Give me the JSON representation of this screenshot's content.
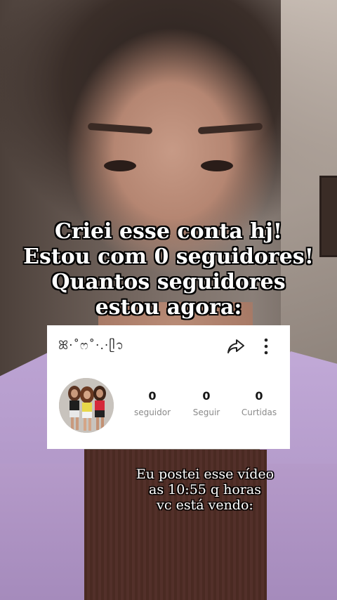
{
  "caption_top": {
    "lines": [
      "Criei esse conta hj!",
      "Estou com 0 seguidores!",
      "Quantos seguidores",
      "estou agora:"
    ]
  },
  "profile_card": {
    "username": "ꕤ·˚ෆ˚·.·ᥫ᭡",
    "share_icon": "share-arrow-icon",
    "more_icon": "vertical-dots-icon",
    "stats": [
      {
        "value": "0",
        "label": "seguidor"
      },
      {
        "value": "0",
        "label": "Seguir"
      },
      {
        "value": "0",
        "label": "Curtidas"
      }
    ]
  },
  "caption_bottom": {
    "lines": [
      "Eu postei esse vídeo",
      "as 10:55 q horas",
      "vc está vendo:"
    ]
  },
  "colors": {
    "card_bg": "#ffffff",
    "stat_label": "#8a8a8a",
    "caption_text": "#ffffff"
  }
}
